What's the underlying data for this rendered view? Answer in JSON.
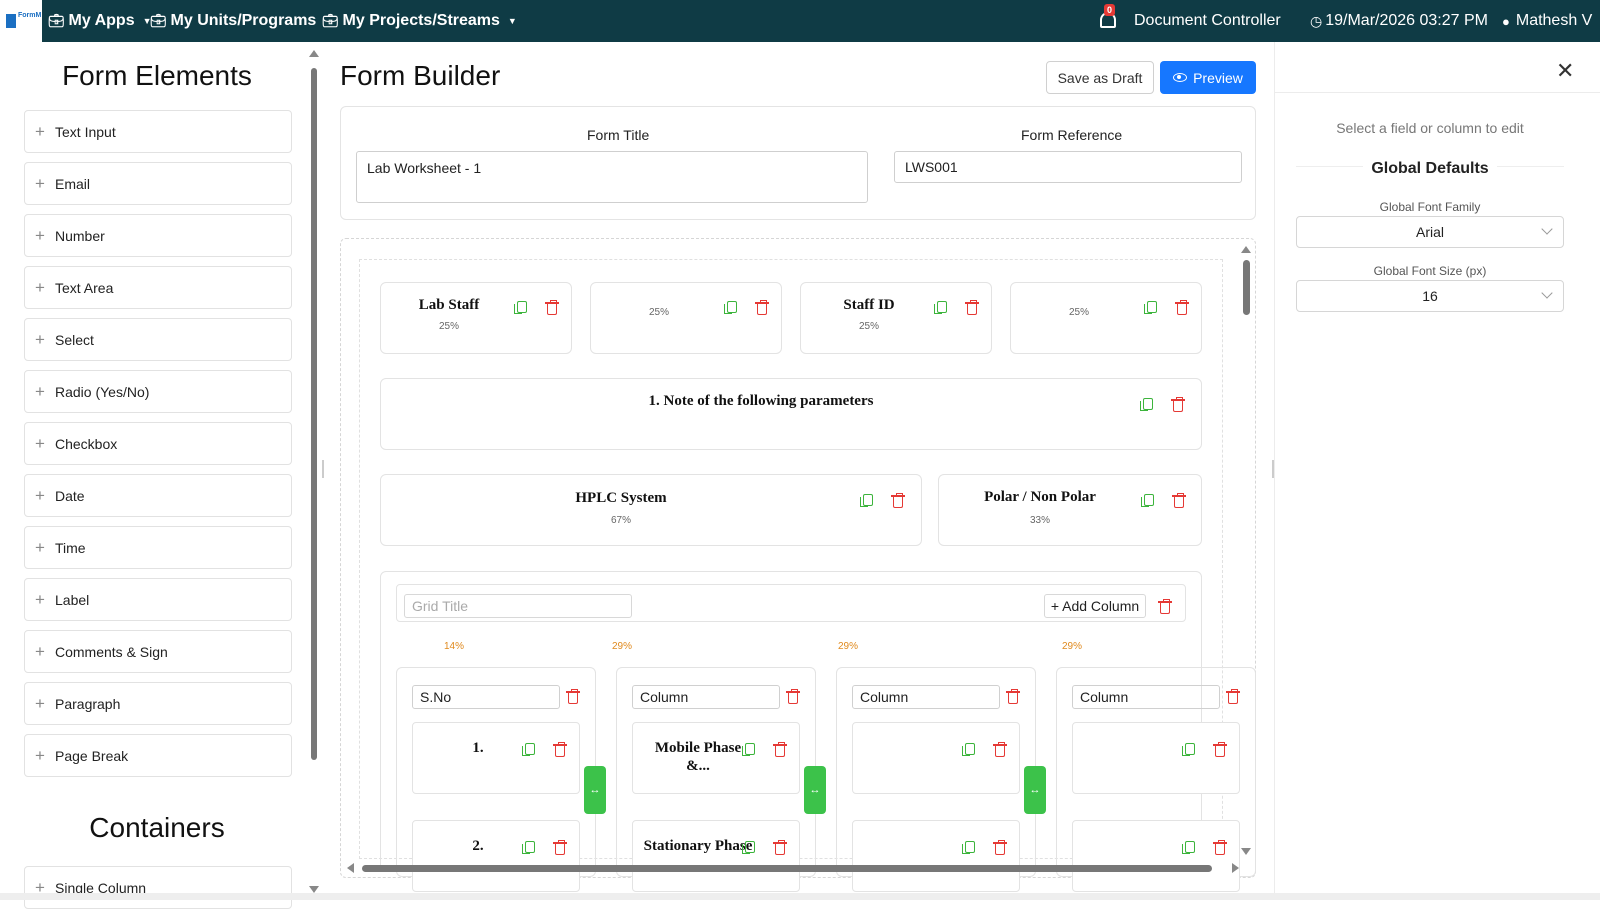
{
  "topbar": {
    "nav": [
      {
        "label": "My Apps",
        "icon": "briefcase-icon"
      },
      {
        "label": "My Units/Programs",
        "icon": "briefcase-icon"
      },
      {
        "label": "My Projects/Streams",
        "icon": "briefcase-icon"
      }
    ],
    "notification_count": "0",
    "role": "Document Controller",
    "datetime": "19/Mar/2026 03:27 PM",
    "user": "Mathesh V"
  },
  "left": {
    "heading": "Form Elements",
    "elements": [
      "Text Input",
      "Email",
      "Number",
      "Text Area",
      "Select",
      "Radio (Yes/No)",
      "Checkbox",
      "Date",
      "Time",
      "Label",
      "Comments & Sign",
      "Paragraph",
      "Page Break"
    ],
    "containers_heading": "Containers",
    "containers": [
      "Single Column"
    ]
  },
  "center": {
    "title": "Form Builder",
    "save_draft": "Save as Draft",
    "preview": "Preview",
    "form_title_label": "Form Title",
    "form_title_value": "Lab Worksheet - 1",
    "form_ref_label": "Form Reference",
    "form_ref_value": "LWS001",
    "row1": [
      {
        "title": "Lab Staff",
        "pct": "25%"
      },
      {
        "title": "",
        "pct": "25%"
      },
      {
        "title": "Staff ID",
        "pct": "25%"
      },
      {
        "title": "",
        "pct": "25%"
      }
    ],
    "note": "1. Note of the following parameters",
    "row3": [
      {
        "title": "HPLC System",
        "pct": "67%"
      },
      {
        "title": "Polar / Non Polar",
        "pct": "33%"
      }
    ],
    "grid": {
      "title_placeholder": "Grid Title",
      "add_column": "+ Add Column",
      "percents": [
        "14%",
        "29%",
        "29%",
        "29%"
      ],
      "columns": [
        {
          "name": "S.No",
          "cells": [
            "1.",
            "2."
          ]
        },
        {
          "name": "Column",
          "cells": [
            "Mobile Phase &...",
            "Stationary Phase"
          ]
        },
        {
          "name": "Column",
          "cells": [
            "",
            ""
          ]
        },
        {
          "name": "Column",
          "cells": [
            "",
            ""
          ]
        }
      ],
      "resize_handle": "↔"
    }
  },
  "right": {
    "hint": "Select a field or column to edit",
    "global_defaults": "Global Defaults",
    "font_family_label": "Global Font Family",
    "font_family_value": "Arial",
    "font_size_label": "Global Font Size (px)",
    "font_size_value": "16"
  }
}
